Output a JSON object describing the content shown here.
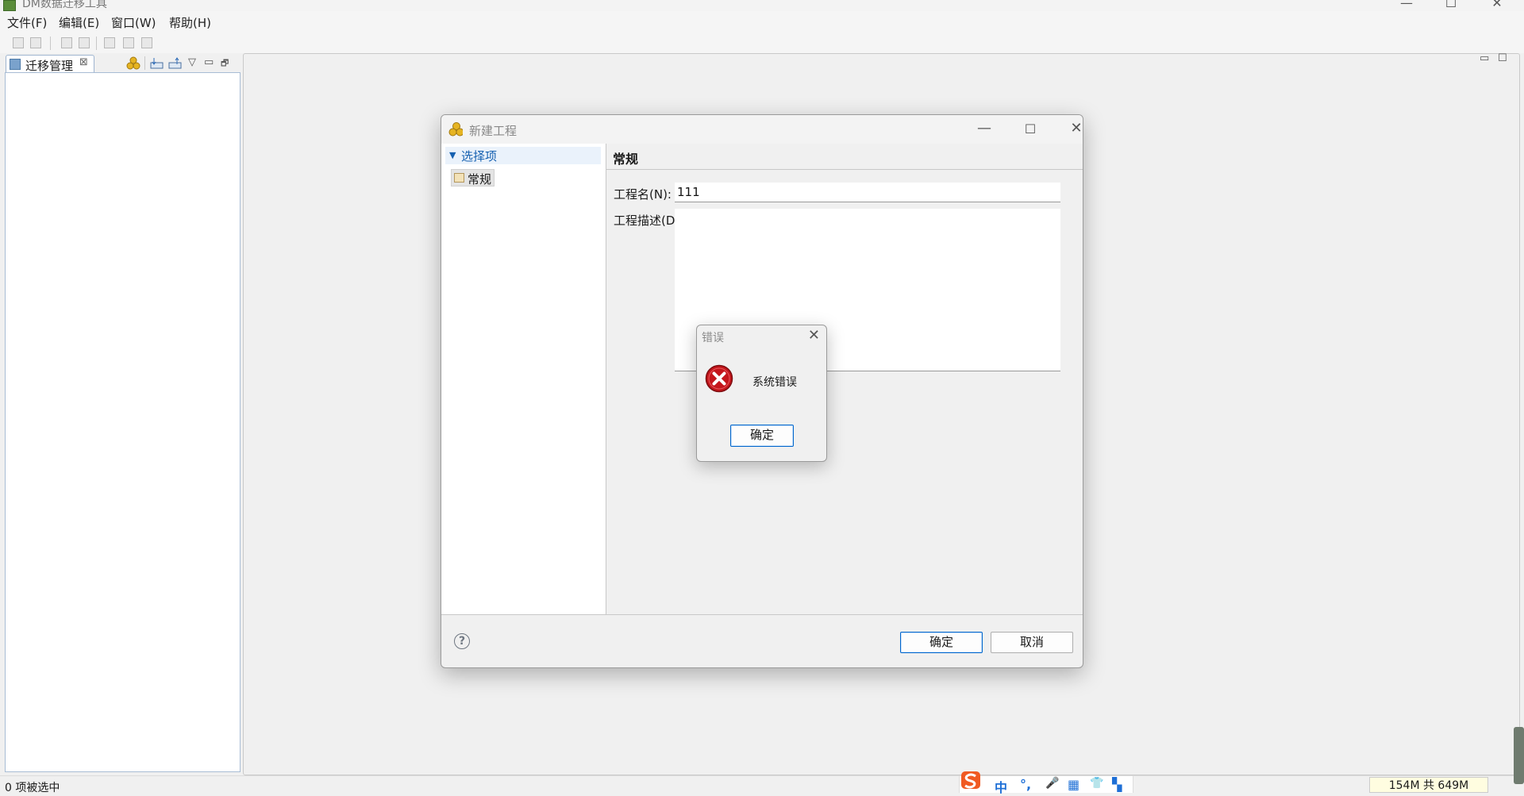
{
  "window": {
    "title": "DM数据迁移工具",
    "minimize": "—",
    "maximize": "☐",
    "close": "✕"
  },
  "menu": [
    "文件(F)",
    "编辑(E)",
    "窗口(W)",
    "帮助(H)"
  ],
  "left_view": {
    "tab_label": "迁移管理",
    "tab_close": "⊠",
    "min": "▭",
    "restore": "🗗"
  },
  "editor_area": {
    "min": "▭",
    "max": "☐"
  },
  "dialog": {
    "title": "新建工程",
    "nav_header": "选择项",
    "nav_item": "常规",
    "page_title": "常规",
    "name_label": "工程名(N):",
    "name_value": "111",
    "desc_label": "工程描述(D):",
    "desc_value": "",
    "ok": "确定",
    "cancel": "取消",
    "help": "?"
  },
  "error_dialog": {
    "title": "错误",
    "message": "系统错误",
    "ok": "确定",
    "close": "✕"
  },
  "status": {
    "selection": "0 项被选中",
    "memory": "154M 共 649M"
  },
  "ime": [
    "中",
    "°,",
    "🎤",
    "▦",
    "👕",
    "▚"
  ],
  "colors": {
    "accent": "#0066cc",
    "nav_link": "#1560b0",
    "error_red": "#c4161c",
    "ime_blue": "#1e6fd6",
    "ime_logo": "#f05a22"
  }
}
